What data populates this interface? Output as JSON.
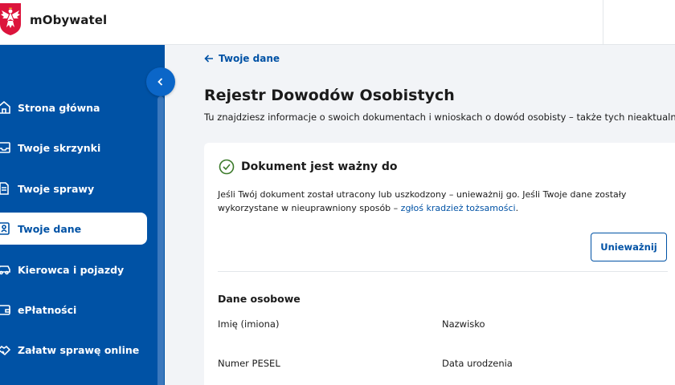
{
  "header": {
    "app_name": "mObywatel",
    "logo_icon": "polish-eagle-emblem"
  },
  "sidebar": {
    "collapse_icon": "chevron-left-icon",
    "items": [
      {
        "label": "Strona główna",
        "icon": "home-icon",
        "active": false
      },
      {
        "label": "Twoje skrzynki",
        "icon": "inbox-icon",
        "active": false
      },
      {
        "label": "Twoje sprawy",
        "icon": "document-icon",
        "active": false
      },
      {
        "label": "Twoje dane",
        "icon": "id-card-icon",
        "active": true
      },
      {
        "label": "Kierowca i pojazdy",
        "icon": "car-icon",
        "active": false
      },
      {
        "label": "ePłatności",
        "icon": "wallet-icon",
        "active": false
      },
      {
        "label": "Załatw sprawę online",
        "icon": "handshake-icon",
        "active": false
      }
    ]
  },
  "main": {
    "back_link": "Twoje dane",
    "title": "Rejestr Dowodów Osobistych",
    "description": "Tu znajdziesz informacje o swoich dokumentach i wnioskach o dowód osobisty – także tych nieaktualnych.",
    "card": {
      "status_title": "Dokument jest ważny do",
      "info_text": "Jeśli Twój dokument został utracony lub uszkodzony – unieważnij go. Jeśli Twoje dane zostały wykorzystane w nieuprawniony sposób – ",
      "info_link": "zgłoś kradzież tożsamości",
      "info_end": ".",
      "invalidate_button": "Unieważnij",
      "section_title": "Dane osobowe",
      "fields": {
        "first_name": "Imię (imiona)",
        "last_name": "Nazwisko",
        "pesel": "Numer PESEL",
        "birth_date": "Data urodzenia"
      }
    }
  },
  "colors": {
    "primary": "#0052a5",
    "background": "#f2f4f7",
    "success": "#3b7a2a"
  }
}
